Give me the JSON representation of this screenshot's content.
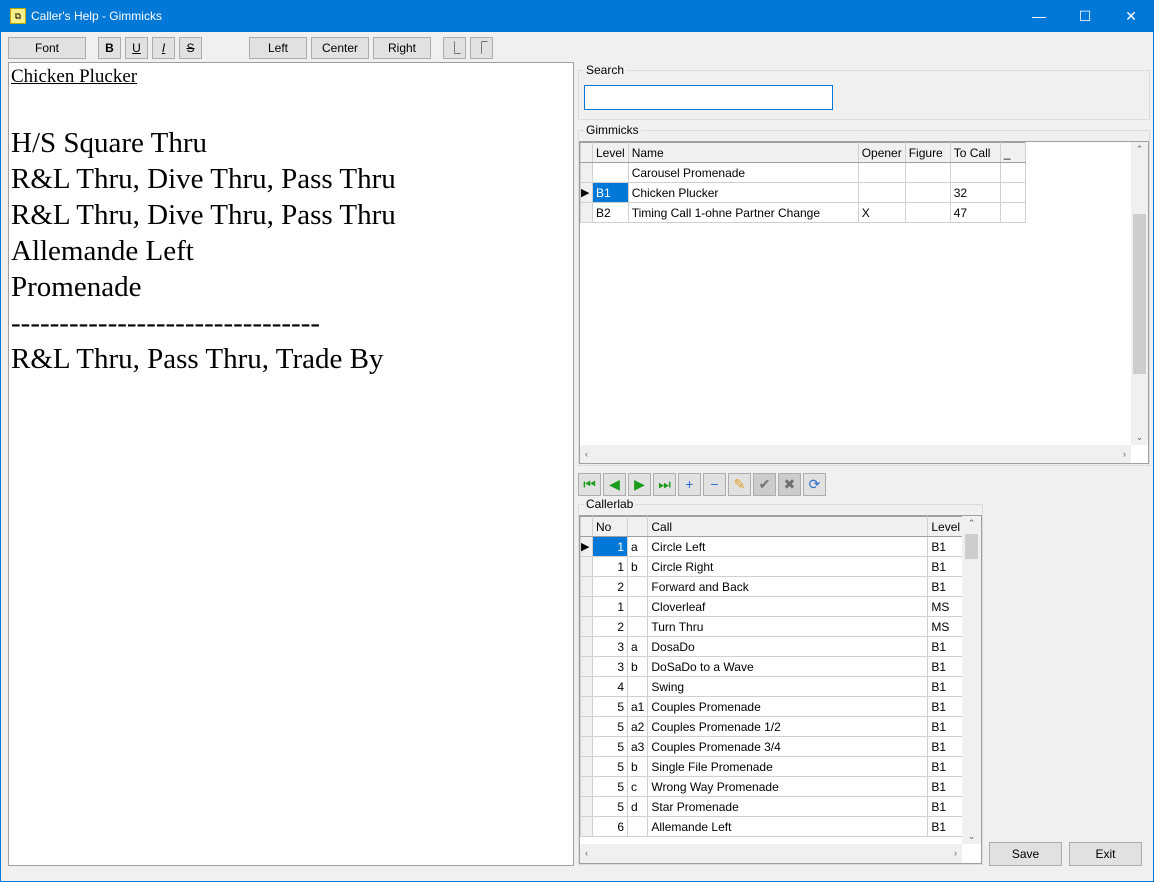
{
  "window": {
    "title": "Caller's Help - Gimmicks",
    "minimize": "—",
    "maximize": "☐",
    "close": "✕"
  },
  "toolbar": {
    "font": "Font",
    "bold": "B",
    "underline": "U",
    "italic": "I",
    "strike": "S",
    "left": "Left",
    "center": "Center",
    "right": "Right",
    "indent_left": "⎿",
    "indent_right": "⎾"
  },
  "editor": {
    "heading": "Chicken Plucker",
    "lines": [
      "",
      "H/S Square Thru",
      "R&L Thru, Dive Thru, Pass Thru",
      "R&L Thru, Dive Thru, Pass Thru",
      "Allemande Left",
      "Promenade",
      "--------------------------------",
      "R&L Thru, Pass Thru, Trade By"
    ]
  },
  "search": {
    "label": "Search",
    "value": ""
  },
  "gimmicks": {
    "label": "Gimmicks",
    "columns": [
      "Level",
      "Name",
      "Opener",
      "Figure",
      "To Call",
      "_"
    ],
    "rows": [
      [
        "",
        "Carousel Promenade",
        "",
        "",
        "",
        ""
      ],
      [
        "B1",
        "Chicken Plucker",
        "",
        "",
        "32",
        ""
      ],
      [
        "B2",
        "Timing Call 1-ohne Partner Change",
        "X",
        "",
        "47",
        ""
      ]
    ],
    "selected_row": 1
  },
  "navigator": [
    "first",
    "prior",
    "next",
    "last",
    "insert",
    "delete",
    "edit",
    "post",
    "cancel",
    "refresh"
  ],
  "callerlab": {
    "label": "Callerlab",
    "columns": [
      "No",
      "",
      "Call",
      "Level"
    ],
    "rows": [
      [
        "1",
        "a",
        "Circle Left",
        "B1"
      ],
      [
        "1",
        "b",
        "Circle Right",
        "B1"
      ],
      [
        "2",
        "",
        "Forward and Back",
        "B1"
      ],
      [
        "1",
        "",
        "Cloverleaf",
        "MS"
      ],
      [
        "2",
        "",
        "Turn Thru",
        "MS"
      ],
      [
        "3",
        "a",
        "DosaDo",
        "B1"
      ],
      [
        "3",
        "b",
        "DoSaDo to a Wave",
        "B1"
      ],
      [
        "4",
        "",
        "Swing",
        "B1"
      ],
      [
        "5",
        "a1",
        "Couples Promenade",
        "B1"
      ],
      [
        "5",
        "a2",
        "Couples Promenade 1/2",
        "B1"
      ],
      [
        "5",
        "a3",
        "Couples Promenade 3/4",
        "B1"
      ],
      [
        "5",
        "b",
        "Single File Promenade",
        "B1"
      ],
      [
        "5",
        "c",
        "Wrong Way Promenade",
        "B1"
      ],
      [
        "5",
        "d",
        "Star Promenade",
        "B1"
      ],
      [
        "6",
        "",
        "Allemande Left",
        "B1"
      ]
    ],
    "selected_row": 0
  },
  "buttons": {
    "save": "Save",
    "exit": "Exit"
  }
}
